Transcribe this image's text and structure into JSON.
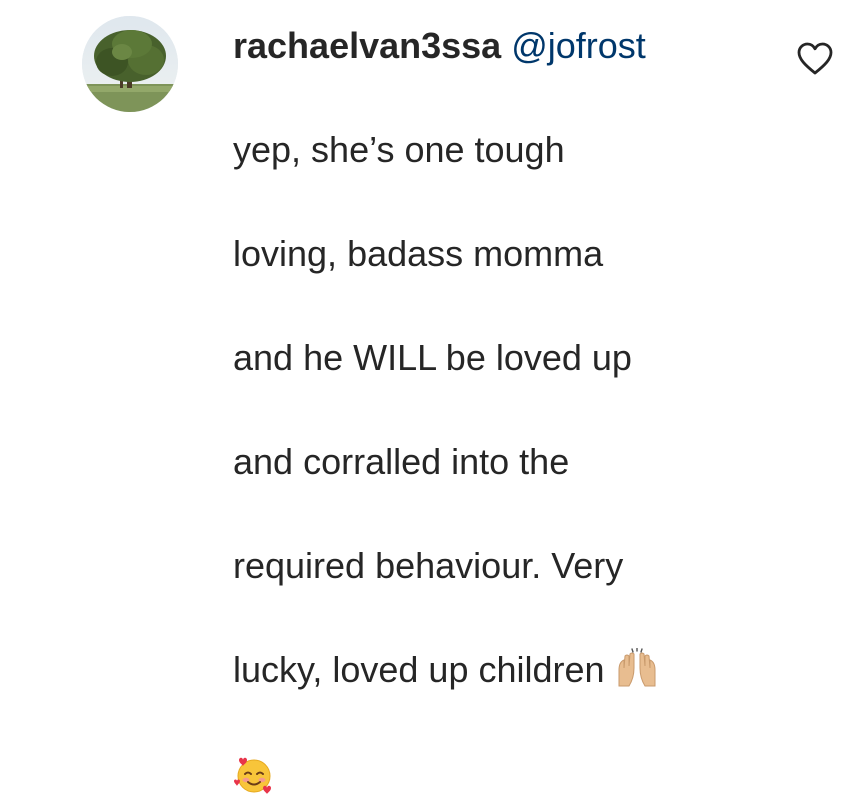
{
  "comment": {
    "username": "rachaelvan3ssa",
    "mention": "@jofrost",
    "lines": [
      "yep, she’s one tough",
      "loving, badass momma",
      "and he WILL be loved up",
      "and corralled into the",
      "required behaviour. Very",
      "lucky, loved up children"
    ],
    "emojis": [
      "raising-hands-emoji",
      "smiling-face-with-hearts-emoji"
    ],
    "avatar_icon": "tree-photo-avatar",
    "like_icon": "heart-outline-icon"
  },
  "colors": {
    "text": "#262626",
    "mention": "#00376b",
    "background": "#ffffff"
  }
}
